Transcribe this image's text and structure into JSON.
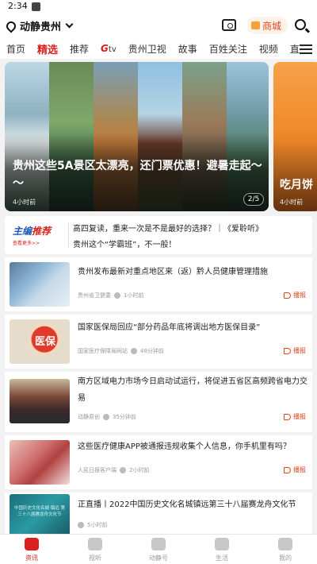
{
  "status": {
    "time": "2:34"
  },
  "header": {
    "location": "动静贵州",
    "mall_label": "商城"
  },
  "tabs": [
    "首页",
    "精选",
    "推荐",
    "G",
    "tv",
    "贵州卫视",
    "故事",
    "百姓关注",
    "视频",
    "直"
  ],
  "banner": {
    "title": "贵州这些5A景区太漂亮，还门票优惠！避暑走起～～",
    "time": "4小时前",
    "pager": "2/5",
    "next_title": "吃月饼",
    "next_time": "4小时前"
  },
  "editor_pick": {
    "badge_main": "主编",
    "badge_main_accent": "推荐",
    "badge_sub": "查看更多>>",
    "lines": [
      "高四复读，重来一次是不是最好的选择？｜《爱聆听》",
      "贵州这个“学霸班”，不一般！"
    ]
  },
  "news": [
    {
      "title": "贵州发布最新对重点地区来（返）黔人员健康管理措施",
      "source": "贵州省卫健委",
      "time": "1小时前",
      "broadcast": "播报"
    },
    {
      "title": "国家医保局回应“部分药品年底将调出地方医保目录”",
      "source": "国家医疗保障局网站",
      "time": "48分钟前",
      "broadcast": "播报",
      "thumb_text": "医保"
    },
    {
      "title": "南方区域电力市场今日启动试运行，将促进五省区高频跨省电力交易",
      "source": "动静原创",
      "time": "35分钟前",
      "broadcast": "播报"
    },
    {
      "title": "这些医疗健康APP被通报违规收集个人信息，你手机里有吗？",
      "source": "人民日报客户端",
      "time": "2小时前",
      "broadcast": "播报"
    },
    {
      "title": "正直播丨2022中国历史文化名城镇远第三十八届赛龙舟文化节",
      "time": "5小时前",
      "thumb_text": "中国历史文化名城·镇远 第三十八届赛龙舟文化节"
    }
  ],
  "bottom_nav": [
    "资讯",
    "视听",
    "动静号",
    "生活",
    "我的"
  ],
  "colors": {
    "accent": "#d8201e",
    "broadcast": "#e0471d",
    "editor_blue": "#1f58b0"
  }
}
